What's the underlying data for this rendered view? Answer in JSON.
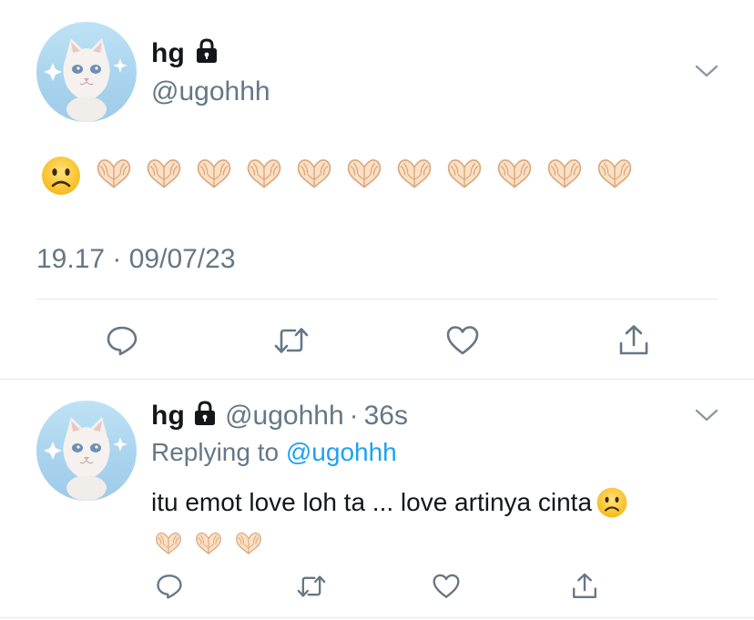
{
  "main_tweet": {
    "display_name": "hg",
    "handle": "@ugohhh",
    "emoji_sad": "🙁",
    "heart_hands_count": 11,
    "timestamp": "19.17 · 09/07/23",
    "icons": {
      "avatar": "cat-avatar-icon",
      "lock": "lock-icon",
      "more": "chevron-down-icon",
      "reply": "reply-icon",
      "retweet": "retweet-icon",
      "like": "heart-icon",
      "share": "share-icon"
    }
  },
  "reply_tweet": {
    "display_name": "hg",
    "handle": "@ugohhh",
    "time_sep": "·",
    "time": "36s",
    "replying_label": "Replying to",
    "replying_to": "@ugohhh",
    "text": "itu emot love loh ta ... love artinya cinta",
    "emoji_sad": "🙁",
    "heart_hands_count": 3
  },
  "colors": {
    "text": "#14171a",
    "muted": "#657786",
    "link": "#1da1f2",
    "divider": "#e1e8ed",
    "icon": "#657786"
  }
}
